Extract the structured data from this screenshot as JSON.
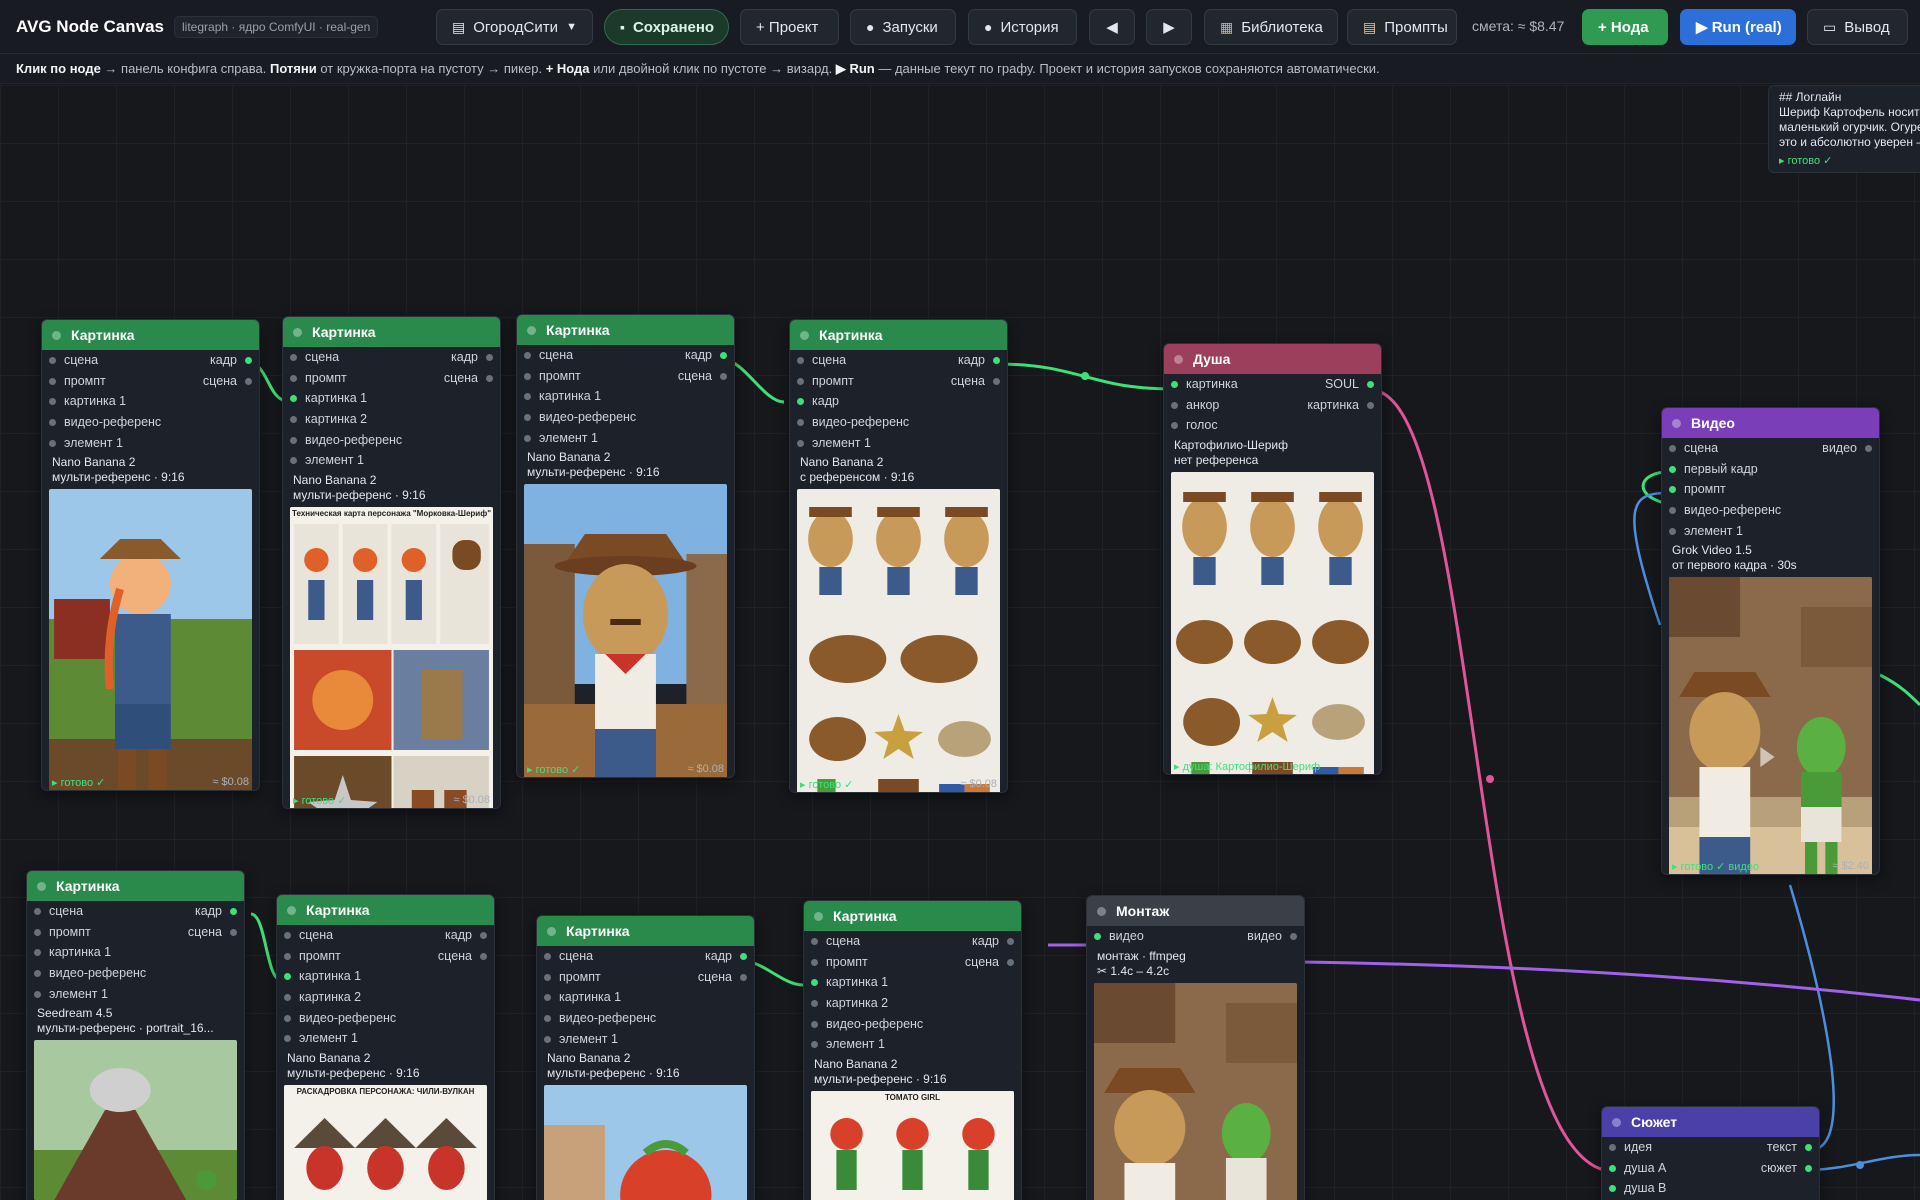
{
  "topbar": {
    "app_title": "AVG Node Canvas",
    "tagline": "litegraph · ядро ComfyUI · real-gen",
    "project": "ОгородСити",
    "saved": "Сохранено",
    "project_btn": "+ Проект",
    "runs_btn": "Запуски",
    "history_btn": "История",
    "undo_btn": "◀",
    "redo_btn": "▶",
    "library_btn": "Библиотека",
    "prompts_btn": "Промпты",
    "estimate": "смета: ≈ $8.47",
    "add_node_btn": "+ Нода",
    "run_btn": "▶ Run (real)",
    "output_btn": "Вывод"
  },
  "hint": {
    "b1": "Клик по ноде",
    "t1": " → панель конфига справа. ",
    "b2": "Потяни",
    "t2": " от кружка-порта на пустоту → пикер. ",
    "b3": "+ Нода",
    "t3": " или двойной клик по пустоте → визард. ",
    "b4": "▶ Run",
    "t4": " — данные текут по графу. Проект и история запусков сохраняются автоматически."
  },
  "colors": {
    "green": "#2a8a4b",
    "soul": "#9b3f5c",
    "video": "#7a3fb8",
    "montage": "#3a3f48",
    "story": "#4b3fa8",
    "accent_run": "#2d6fd8",
    "accent_add": "#2e9a52"
  },
  "note": {
    "l1": "## Логлайн",
    "l2": "Шериф Картофель носит в",
    "l3": "маленький огурчик. Огурец",
    "l4": "это и абсолютно уверен —",
    "status": "▸ готово ✓"
  },
  "n1": {
    "title": "Картинка",
    "ins": [
      "сцена",
      "промпт",
      "картинка 1",
      "видео-референс",
      "элемент 1"
    ],
    "out1": "кадр",
    "out2": "сцена",
    "model": "Nano Banana 2",
    "mode": "мульти-референс · 9:16",
    "status": "▸ готово ✓",
    "cost": "≈ $0.08"
  },
  "n2": {
    "title": "Картинка",
    "ins": [
      "сцена",
      "промпт",
      "картинка 1",
      "картинка 2",
      "видео-референс",
      "элемент 1"
    ],
    "out1": "кадр",
    "out2": "сцена",
    "model": "Nano Banana 2",
    "mode": "мульти-референс · 9:16",
    "sheet_title": "Техническая карта персонажа \"Морковка-Шериф\"",
    "status": "▸ готово ✓",
    "cost": "≈ $0.08"
  },
  "n3": {
    "title": "Картинка",
    "ins": [
      "сцена",
      "промпт",
      "картинка 1",
      "видео-референс",
      "элемент 1"
    ],
    "out1": "кадр",
    "out2": "сцена",
    "model": "Nano Banana 2",
    "mode": "мульти-референс · 9:16",
    "status": "▸ готово ✓",
    "cost": "≈ $0.08"
  },
  "n4": {
    "title": "Картинка",
    "ins": [
      "сцена",
      "промпт",
      "кадр",
      "видео-референс",
      "элемент 1"
    ],
    "out1": "кадр",
    "out2": "сцена",
    "model": "Nano Banana 2",
    "mode": "с референсом · 9:16",
    "status": "▸ готово ✓",
    "cost": "≈ $0.08"
  },
  "soul": {
    "title": "Душа",
    "ins": [
      "картинка",
      "анкор",
      "голос"
    ],
    "out1": "SOUL",
    "out2": "картинка",
    "name": "Картофилио-Шериф",
    "ref": "нет референса",
    "status": "▸ душа: Картофилио-Шериф"
  },
  "video": {
    "title": "Видео",
    "ins": [
      "сцена",
      "первый кадр",
      "промпт",
      "видео-референс",
      "элемент 1"
    ],
    "out1": "видео",
    "model": "Grok Video 1.5",
    "mode": "от первого кадра · 30s",
    "status": "▸ готово ✓ видео",
    "cost": "≈ $2.40"
  },
  "n5": {
    "title": "Картинка",
    "ins": [
      "сцена",
      "промпт",
      "картинка 1",
      "видео-референс",
      "элемент 1"
    ],
    "out1": "кадр",
    "out2": "сцена",
    "model": "Seedream 4.5",
    "mode": "мульти-референс · portrait_16..."
  },
  "n6": {
    "title": "Картинка",
    "ins": [
      "сцена",
      "промпт",
      "картинка 1",
      "картинка 2",
      "видео-референс",
      "элемент 1"
    ],
    "out1": "кадр",
    "out2": "сцена",
    "model": "Nano Banana 2",
    "mode": "мульти-референс · 9:16",
    "sheet_title": "РАСКАДРОВКА ПЕРСОНАЖА: ЧИЛИ-ВУЛКАН"
  },
  "n7": {
    "title": "Картинка",
    "ins": [
      "сцена",
      "промпт",
      "картинка 1",
      "видео-референс",
      "элемент 1"
    ],
    "out1": "кадр",
    "out2": "сцена",
    "model": "Nano Banana 2",
    "mode": "мульти-референс · 9:16"
  },
  "n8": {
    "title": "Картинка",
    "ins": [
      "сцена",
      "промпт",
      "картинка 1",
      "картинка 2",
      "видео-референс",
      "элемент 1"
    ],
    "out1": "кадр",
    "out2": "сцена",
    "model": "Nano Banana 2",
    "mode": "мульти-референс · 9:16",
    "sheet_title": "TOMATO GIRL"
  },
  "montage": {
    "title": "Монтаж",
    "in1": "видео",
    "out1": "видео",
    "mode": "монтаж · ffmpeg",
    "range": "✂ 1.4с – 4.2с"
  },
  "story": {
    "title": "Сюжет",
    "ins": [
      "идея",
      "душа А",
      "душа В"
    ],
    "out1": "текст",
    "out2": "сюжет"
  }
}
